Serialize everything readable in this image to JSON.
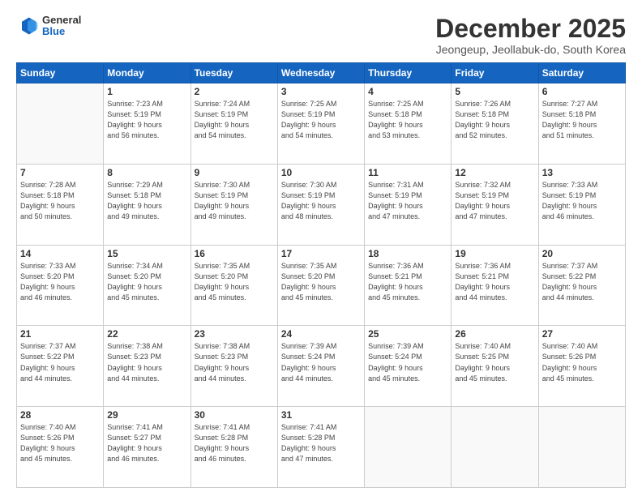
{
  "logo": {
    "general": "General",
    "blue": "Blue"
  },
  "header": {
    "month": "December 2025",
    "location": "Jeongeup, Jeollabuk-do, South Korea"
  },
  "weekdays": [
    "Sunday",
    "Monday",
    "Tuesday",
    "Wednesday",
    "Thursday",
    "Friday",
    "Saturday"
  ],
  "weeks": [
    [
      {
        "day": "",
        "info": ""
      },
      {
        "day": "1",
        "info": "Sunrise: 7:23 AM\nSunset: 5:19 PM\nDaylight: 9 hours\nand 56 minutes."
      },
      {
        "day": "2",
        "info": "Sunrise: 7:24 AM\nSunset: 5:19 PM\nDaylight: 9 hours\nand 54 minutes."
      },
      {
        "day": "3",
        "info": "Sunrise: 7:25 AM\nSunset: 5:19 PM\nDaylight: 9 hours\nand 54 minutes."
      },
      {
        "day": "4",
        "info": "Sunrise: 7:25 AM\nSunset: 5:18 PM\nDaylight: 9 hours\nand 53 minutes."
      },
      {
        "day": "5",
        "info": "Sunrise: 7:26 AM\nSunset: 5:18 PM\nDaylight: 9 hours\nand 52 minutes."
      },
      {
        "day": "6",
        "info": "Sunrise: 7:27 AM\nSunset: 5:18 PM\nDaylight: 9 hours\nand 51 minutes."
      }
    ],
    [
      {
        "day": "7",
        "info": "Sunrise: 7:28 AM\nSunset: 5:18 PM\nDaylight: 9 hours\nand 50 minutes."
      },
      {
        "day": "8",
        "info": "Sunrise: 7:29 AM\nSunset: 5:18 PM\nDaylight: 9 hours\nand 49 minutes."
      },
      {
        "day": "9",
        "info": "Sunrise: 7:30 AM\nSunset: 5:19 PM\nDaylight: 9 hours\nand 49 minutes."
      },
      {
        "day": "10",
        "info": "Sunrise: 7:30 AM\nSunset: 5:19 PM\nDaylight: 9 hours\nand 48 minutes."
      },
      {
        "day": "11",
        "info": "Sunrise: 7:31 AM\nSunset: 5:19 PM\nDaylight: 9 hours\nand 47 minutes."
      },
      {
        "day": "12",
        "info": "Sunrise: 7:32 AM\nSunset: 5:19 PM\nDaylight: 9 hours\nand 47 minutes."
      },
      {
        "day": "13",
        "info": "Sunrise: 7:33 AM\nSunset: 5:19 PM\nDaylight: 9 hours\nand 46 minutes."
      }
    ],
    [
      {
        "day": "14",
        "info": "Sunrise: 7:33 AM\nSunset: 5:20 PM\nDaylight: 9 hours\nand 46 minutes."
      },
      {
        "day": "15",
        "info": "Sunrise: 7:34 AM\nSunset: 5:20 PM\nDaylight: 9 hours\nand 45 minutes."
      },
      {
        "day": "16",
        "info": "Sunrise: 7:35 AM\nSunset: 5:20 PM\nDaylight: 9 hours\nand 45 minutes."
      },
      {
        "day": "17",
        "info": "Sunrise: 7:35 AM\nSunset: 5:20 PM\nDaylight: 9 hours\nand 45 minutes."
      },
      {
        "day": "18",
        "info": "Sunrise: 7:36 AM\nSunset: 5:21 PM\nDaylight: 9 hours\nand 45 minutes."
      },
      {
        "day": "19",
        "info": "Sunrise: 7:36 AM\nSunset: 5:21 PM\nDaylight: 9 hours\nand 44 minutes."
      },
      {
        "day": "20",
        "info": "Sunrise: 7:37 AM\nSunset: 5:22 PM\nDaylight: 9 hours\nand 44 minutes."
      }
    ],
    [
      {
        "day": "21",
        "info": "Sunrise: 7:37 AM\nSunset: 5:22 PM\nDaylight: 9 hours\nand 44 minutes."
      },
      {
        "day": "22",
        "info": "Sunrise: 7:38 AM\nSunset: 5:23 PM\nDaylight: 9 hours\nand 44 minutes."
      },
      {
        "day": "23",
        "info": "Sunrise: 7:38 AM\nSunset: 5:23 PM\nDaylight: 9 hours\nand 44 minutes."
      },
      {
        "day": "24",
        "info": "Sunrise: 7:39 AM\nSunset: 5:24 PM\nDaylight: 9 hours\nand 44 minutes."
      },
      {
        "day": "25",
        "info": "Sunrise: 7:39 AM\nSunset: 5:24 PM\nDaylight: 9 hours\nand 45 minutes."
      },
      {
        "day": "26",
        "info": "Sunrise: 7:40 AM\nSunset: 5:25 PM\nDaylight: 9 hours\nand 45 minutes."
      },
      {
        "day": "27",
        "info": "Sunrise: 7:40 AM\nSunset: 5:26 PM\nDaylight: 9 hours\nand 45 minutes."
      }
    ],
    [
      {
        "day": "28",
        "info": "Sunrise: 7:40 AM\nSunset: 5:26 PM\nDaylight: 9 hours\nand 45 minutes."
      },
      {
        "day": "29",
        "info": "Sunrise: 7:41 AM\nSunset: 5:27 PM\nDaylight: 9 hours\nand 46 minutes."
      },
      {
        "day": "30",
        "info": "Sunrise: 7:41 AM\nSunset: 5:28 PM\nDaylight: 9 hours\nand 46 minutes."
      },
      {
        "day": "31",
        "info": "Sunrise: 7:41 AM\nSunset: 5:28 PM\nDaylight: 9 hours\nand 47 minutes."
      },
      {
        "day": "",
        "info": ""
      },
      {
        "day": "",
        "info": ""
      },
      {
        "day": "",
        "info": ""
      }
    ]
  ]
}
